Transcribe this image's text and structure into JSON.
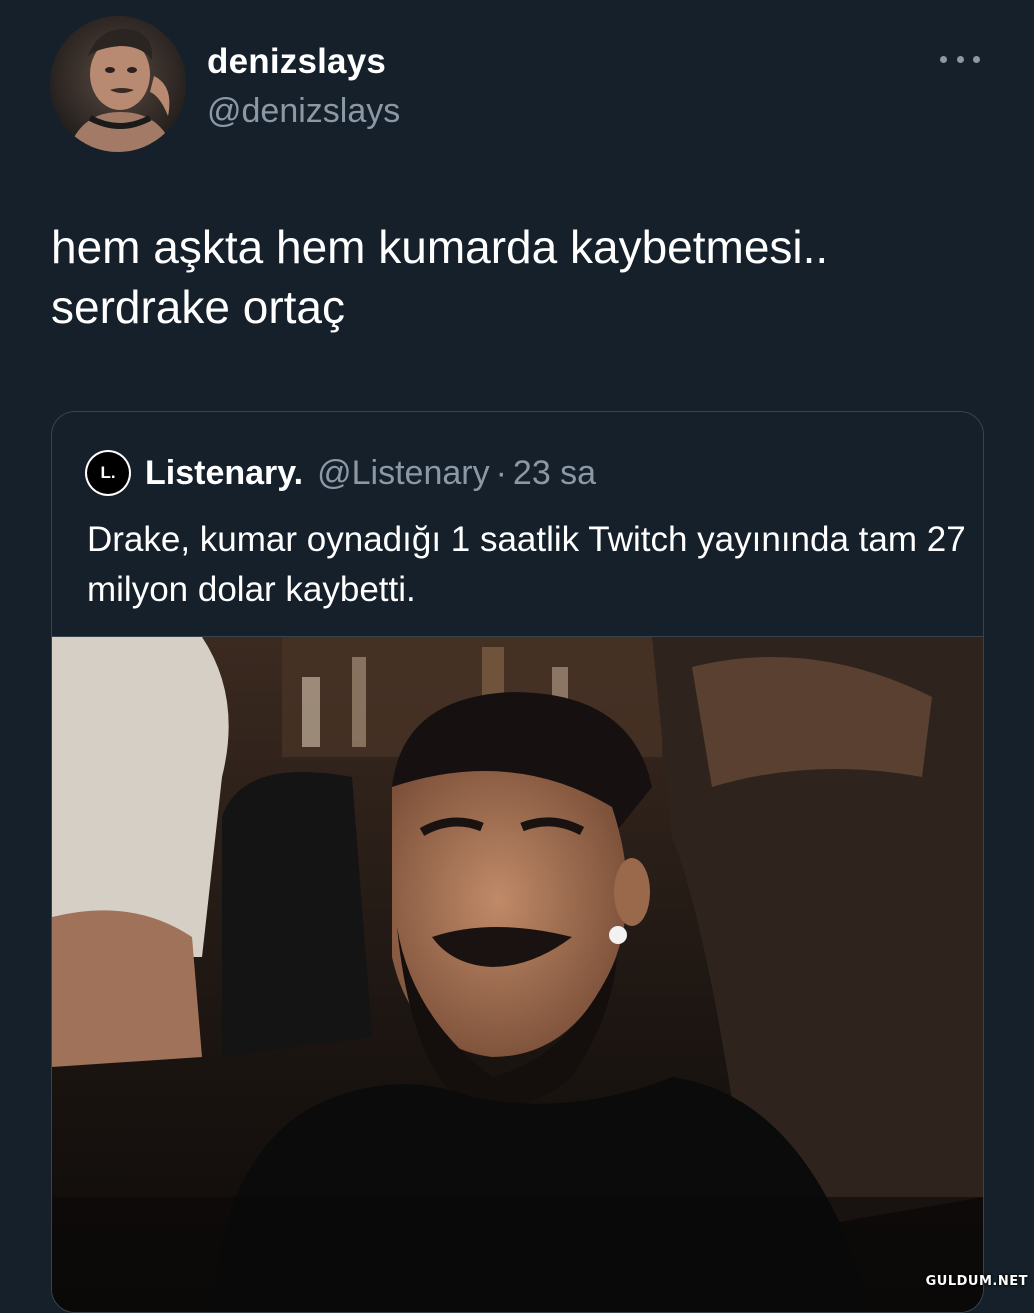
{
  "author": {
    "display_name": "denizslays",
    "handle": "@denizslays"
  },
  "tweet": {
    "text": "hem aşkta hem kumarda kaybetmesi..\nserdrake ortaç"
  },
  "quoted_tweet": {
    "avatar_letter": "L.",
    "display_name": "Listenary.",
    "handle": "@Listenary",
    "separator": "·",
    "time": "23 sa",
    "text": "Drake, kumar oynadığı 1 saatlik Twitch yayınında tam 27 milyon dolar kaybetti."
  },
  "icons": {
    "more": "more-horizontal-icon"
  },
  "watermark": "GULDUM.NET",
  "colors": {
    "background": "#15202b",
    "secondary_text": "#8b98a5",
    "border": "#38444d"
  }
}
